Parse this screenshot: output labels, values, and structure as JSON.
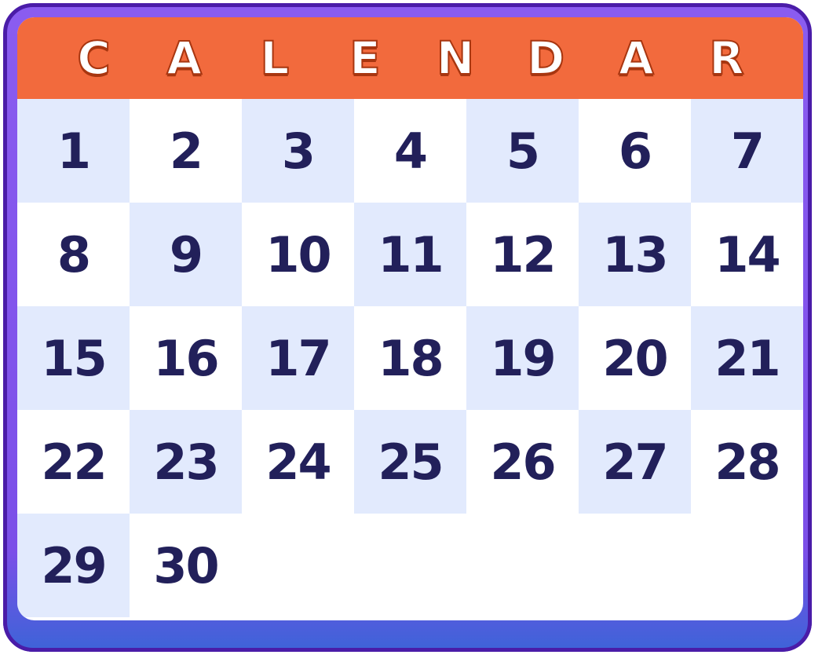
{
  "header": {
    "letters": [
      "C",
      "A",
      "L",
      "E",
      "N",
      "D",
      "A",
      "R"
    ]
  },
  "days": [
    "1",
    "2",
    "3",
    "4",
    "5",
    "6",
    "7",
    "8",
    "9",
    "10",
    "11",
    "12",
    "13",
    "14",
    "15",
    "16",
    "17",
    "18",
    "19",
    "20",
    "21",
    "22",
    "23",
    "24",
    "25",
    "26",
    "27",
    "28",
    "29",
    "30"
  ],
  "colors": {
    "frame": "#7b4fe8",
    "frame_border": "#4a1ca8",
    "base": "#3d64d9",
    "header": "#f26a3d",
    "header_shadow": "#a83610",
    "cell_shade": "#e2eafd",
    "cell_plain": "#ffffff",
    "number": "#22205a"
  }
}
